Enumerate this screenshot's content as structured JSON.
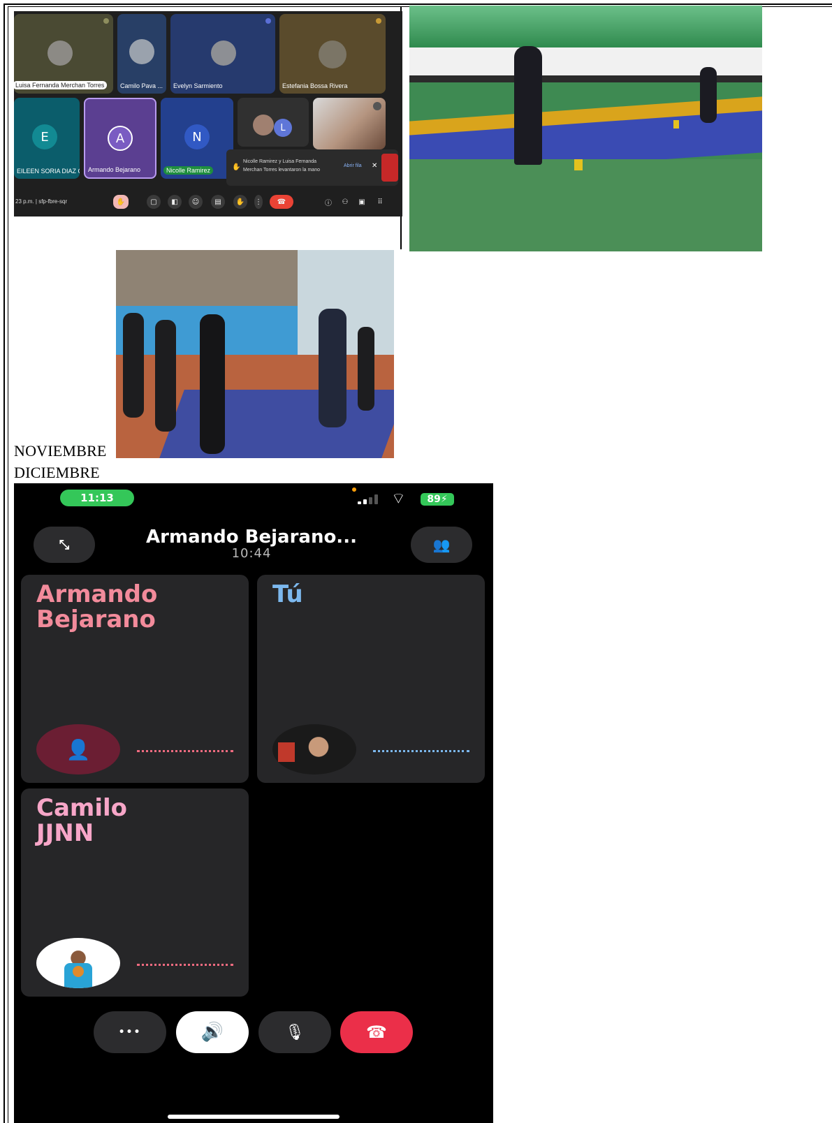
{
  "months": {
    "first": "NOVIEMBRE",
    "second": "DICIEMBRE"
  },
  "meet": {
    "participants": [
      {
        "name": "Luisa Fernanda Merchan Torres"
      },
      {
        "name": "Camilo Pava ..."
      },
      {
        "name": "Evelyn Sarmiento"
      },
      {
        "name": "Estefania Bossa Rivera"
      },
      {
        "name": "EILEEN SORIA DIAZ G...",
        "initial": "E"
      },
      {
        "name": "Armando Bejarano",
        "initial": "A"
      },
      {
        "name": "Nicolle Ramirez",
        "initial": "N"
      },
      {
        "name": "",
        "initial": "L"
      }
    ],
    "toast": {
      "text_line1": "Nicolle Ramirez y Luisa Fernanda",
      "text_line2": "Merchan Torres levantaron la mano",
      "action": "Abrir fila",
      "close": "✕"
    },
    "clock": "23 p.m. | sfp-fbre-sqr",
    "colors": {
      "bg": "#1f1f1f",
      "end_call": "#ea4335",
      "tile_teal": "#0b5d6b",
      "tile_purple": "#5b3f91",
      "tile_blue": "#23408e"
    }
  },
  "phone": {
    "status_time": "11:13",
    "battery": "89",
    "call_title": "Armando Bejarano...",
    "call_duration": "10:44",
    "participants": [
      {
        "name_line1": "Armando",
        "name_line2": "Bejarano",
        "color": "#f28b9b",
        "line_color": "#f06b80"
      },
      {
        "name_line1": "Tú",
        "name_line2": "",
        "color": "#7cb8ee",
        "line_color": "#7cb8ee"
      },
      {
        "name_line1": "Camilo",
        "name_line2": "JJNN",
        "color": "#f7a6c8",
        "line_color": "#f06b80"
      }
    ],
    "buttons": {
      "more": "•••",
      "speaker": "speaker-icon",
      "mute": "mic-off-icon",
      "end": "end-call-icon"
    },
    "colors": {
      "end_call": "#eb2f49",
      "card_bg": "#262628",
      "pill_green": "#34c759"
    }
  }
}
